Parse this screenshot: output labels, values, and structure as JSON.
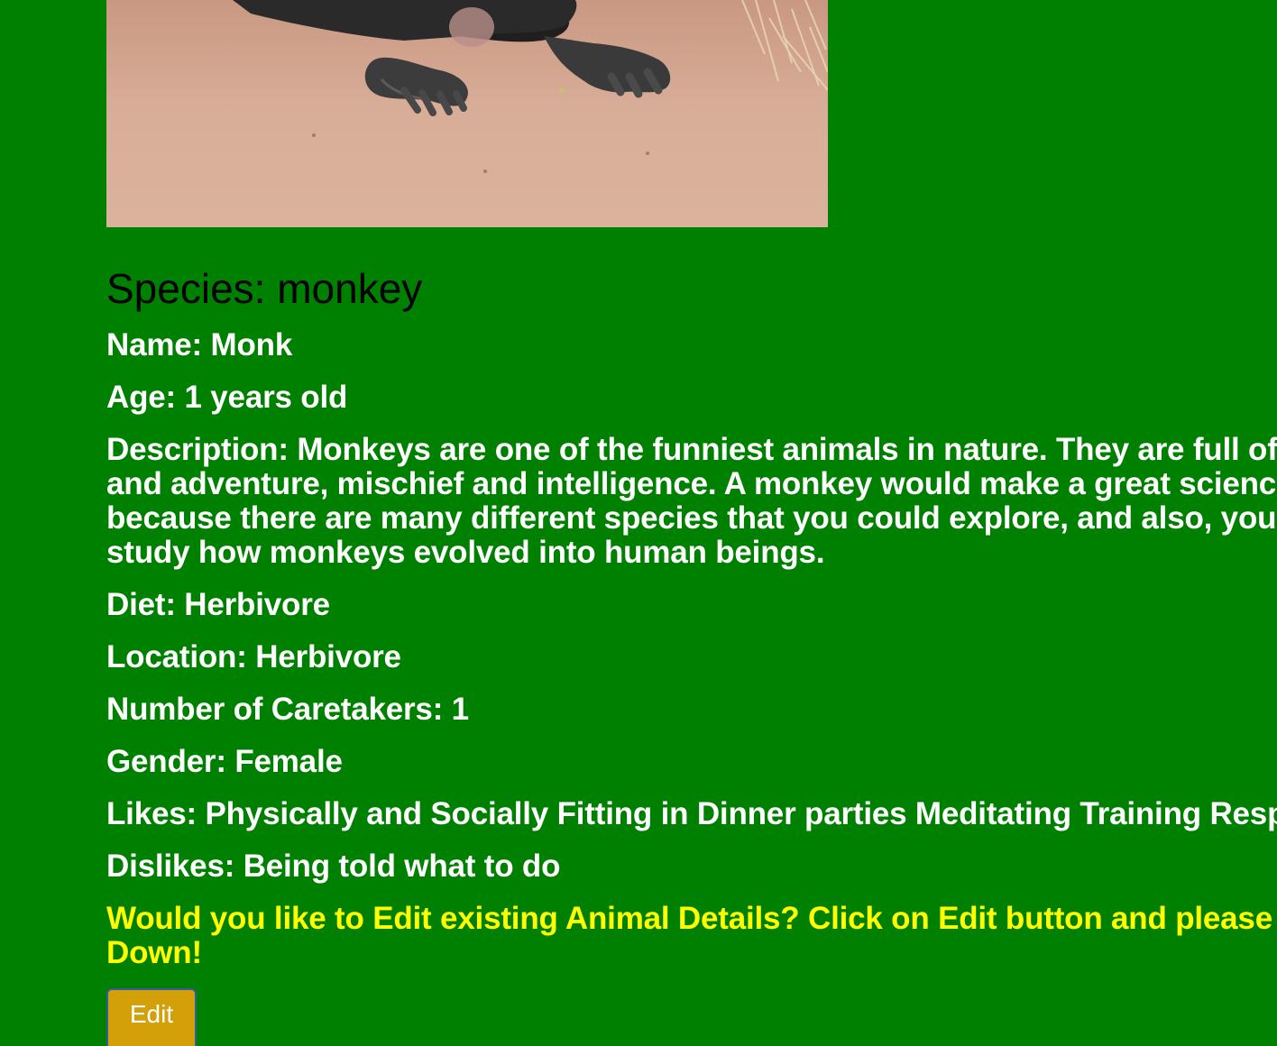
{
  "animal": {
    "species_label": "Species: monkey",
    "name_label": "Name: ",
    "name_value": "Monk",
    "age": "Age: 1 years old",
    "description_lines": [
      "Description: Monkeys are one of the funniest animals in nature. They are full of",
      "and adventure, mischief and intelligence. A monkey would make a great scienc",
      "because there are many different species that you could explore, and also, you",
      "study how monkeys evolved into human beings."
    ],
    "diet": "Diet: Herbivore",
    "location": "Location: Herbivore",
    "caretakers": "Number of Caretakers: 1",
    "gender": "Gender: Female",
    "likes": "Likes: Physically and Socially Fitting in Dinner parties Meditating Training Resp",
    "dislikes": "Dislikes: Being told what to do"
  },
  "prompt": {
    "line1": "Would you like to Edit existing Animal Details? Click on Edit button and please",
    "line2": "Down!"
  },
  "edit_button": {
    "label": "Edit"
  },
  "colors": {
    "background": "#008000",
    "prompt_text": "#ffff00",
    "button_bg": "#d4a00a"
  },
  "image": {
    "icon": "monkey-photo"
  }
}
